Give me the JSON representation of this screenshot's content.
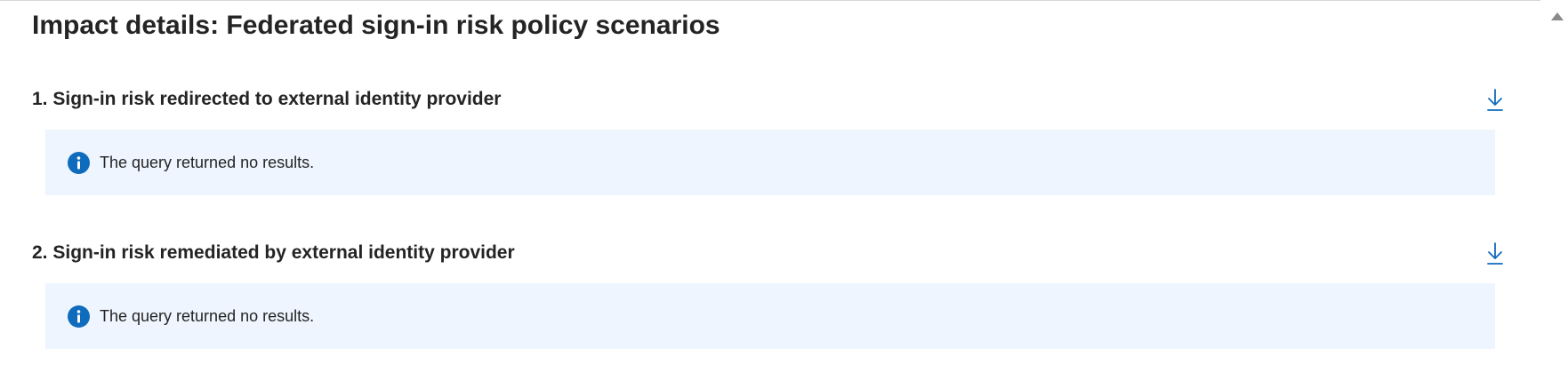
{
  "page": {
    "title": "Impact details: Federated sign-in risk policy scenarios"
  },
  "sections": [
    {
      "title": "1. Sign-in risk redirected to external identity provider",
      "download_icon": "download-icon",
      "message": "The query returned no results.",
      "message_icon": "info-icon"
    },
    {
      "title": "2. Sign-in risk remediated by external identity provider",
      "download_icon": "download-icon",
      "message": "The query returned no results.",
      "message_icon": "info-icon"
    }
  ],
  "colors": {
    "accent": "#0f6cbd",
    "info_icon": "#0f6cbd",
    "info_background": "#eef5fe",
    "text": "#242424"
  }
}
